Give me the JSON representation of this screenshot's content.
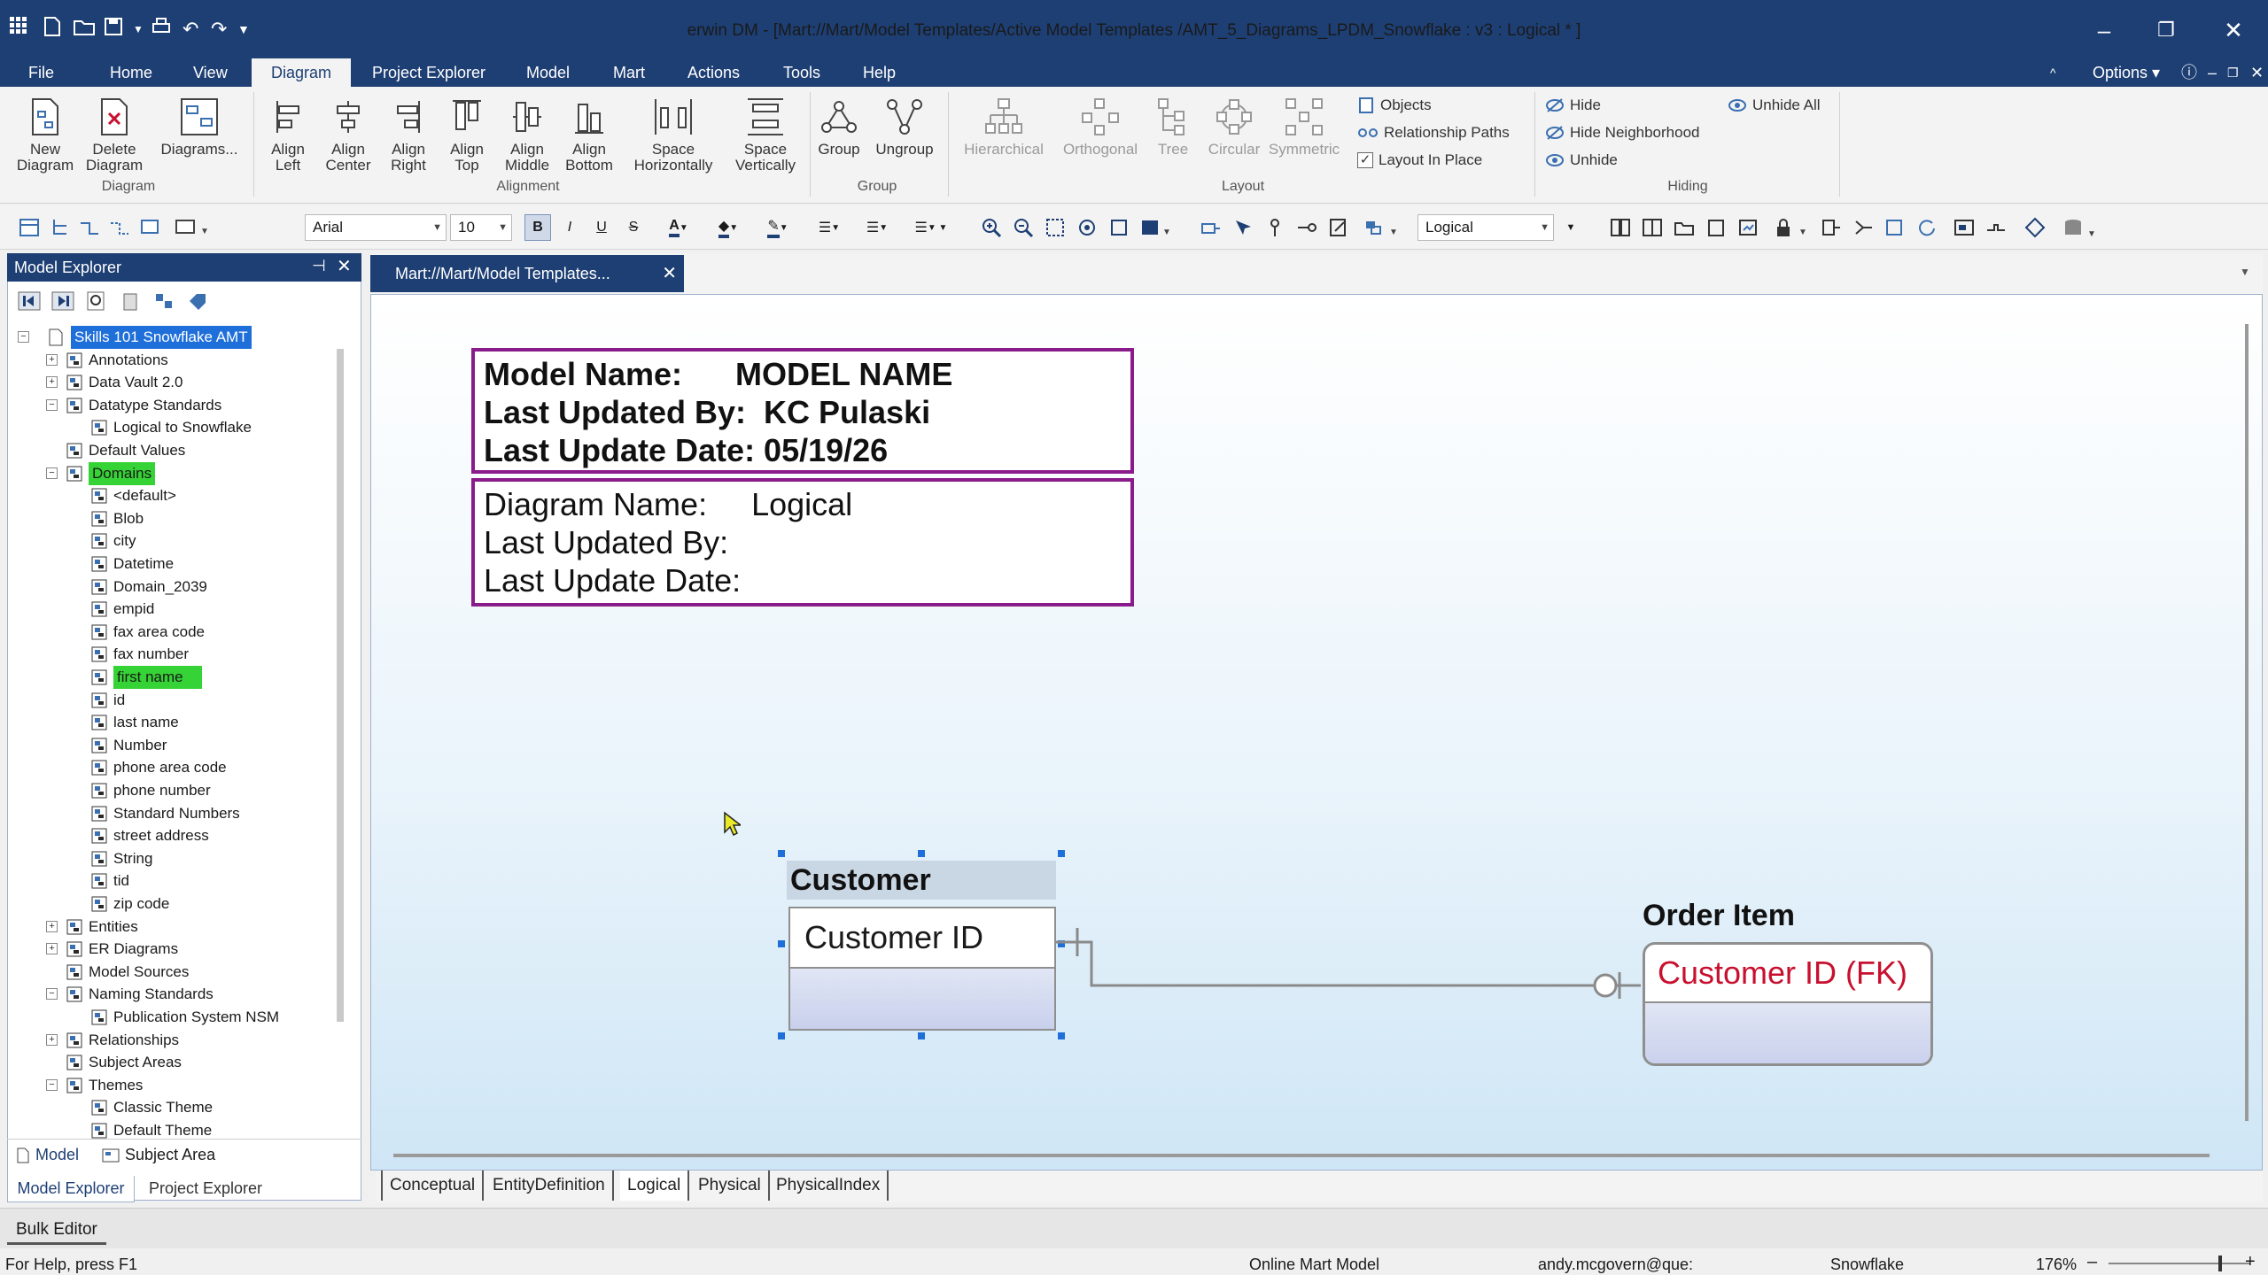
{
  "window": {
    "title": "erwin DM - [Mart://Mart/Model Templates/Active Model Templates /AMT_5_Diagrams_LPDM_Snowflake : v3 : Logical * ]",
    "controls": {
      "minimize": "–",
      "restore": "❐",
      "close": "✕"
    }
  },
  "menu": {
    "items": [
      "File",
      "Home",
      "View",
      "Diagram",
      "Project Explorer",
      "Model",
      "Mart",
      "Actions",
      "Tools",
      "Help"
    ],
    "active": "Diagram",
    "options": "Options"
  },
  "ribbon": {
    "diagram_group": {
      "label": "Diagram",
      "buttons": [
        "New\nDiagram",
        "Delete\nDiagram",
        "Diagrams..."
      ]
    },
    "alignment_group": {
      "label": "Alignment",
      "buttons": [
        "Align\nLeft",
        "Align\nCenter",
        "Align\nRight",
        "Align\nTop",
        "Align\nMiddle",
        "Align\nBottom",
        "Space\nHorizontally",
        "Space\nVertically"
      ]
    },
    "group_group": {
      "label": "Group",
      "buttons": [
        "Group",
        "Ungroup"
      ]
    },
    "layout_group": {
      "label": "Layout",
      "buttons": [
        "Hierarchical",
        "Orthogonal",
        "Tree",
        "Circular",
        "Symmetric"
      ],
      "options": [
        "Objects",
        "Relationship Paths",
        "Layout In Place"
      ],
      "layout_in_place_checked": true
    },
    "hiding_group": {
      "label": "Hiding",
      "buttons": [
        "Hide",
        "Hide Neighborhood",
        "Unhide",
        "Unhide All"
      ]
    }
  },
  "toolbar": {
    "font": "Arial",
    "size": "10",
    "view": "Logical"
  },
  "model_explorer": {
    "title": "Model Explorer",
    "root": "Skills 101 Snowflake AMT",
    "nodes": [
      {
        "label": "Annotations",
        "level": 1,
        "expander": "+"
      },
      {
        "label": "Data Vault 2.0",
        "level": 1,
        "expander": "+"
      },
      {
        "label": "Datatype Standards",
        "level": 1,
        "expander": "−"
      },
      {
        "label": "Logical to Snowflake",
        "level": 2,
        "expander": ""
      },
      {
        "label": "Default Values",
        "level": 1,
        "expander": ""
      },
      {
        "label": "Domains",
        "level": 1,
        "expander": "−",
        "highlight": "green"
      },
      {
        "label": "<default>",
        "level": 2,
        "expander": ""
      },
      {
        "label": "Blob",
        "level": 2,
        "expander": ""
      },
      {
        "label": "city",
        "level": 2,
        "expander": ""
      },
      {
        "label": "Datetime",
        "level": 2,
        "expander": ""
      },
      {
        "label": "Domain_2039",
        "level": 2,
        "expander": ""
      },
      {
        "label": "empid",
        "level": 2,
        "expander": ""
      },
      {
        "label": "fax area code",
        "level": 2,
        "expander": ""
      },
      {
        "label": "fax number",
        "level": 2,
        "expander": ""
      },
      {
        "label": "first name",
        "level": 2,
        "expander": "",
        "highlight": "green"
      },
      {
        "label": "id",
        "level": 2,
        "expander": ""
      },
      {
        "label": "last name",
        "level": 2,
        "expander": ""
      },
      {
        "label": "Number",
        "level": 2,
        "expander": ""
      },
      {
        "label": "phone area code",
        "level": 2,
        "expander": ""
      },
      {
        "label": "phone number",
        "level": 2,
        "expander": ""
      },
      {
        "label": "Standard Numbers",
        "level": 2,
        "expander": ""
      },
      {
        "label": "street address",
        "level": 2,
        "expander": ""
      },
      {
        "label": "String",
        "level": 2,
        "expander": ""
      },
      {
        "label": "tid",
        "level": 2,
        "expander": ""
      },
      {
        "label": "zip code",
        "level": 2,
        "expander": ""
      },
      {
        "label": "Entities",
        "level": 1,
        "expander": "+"
      },
      {
        "label": "ER Diagrams",
        "level": 1,
        "expander": "+"
      },
      {
        "label": "Model Sources",
        "level": 1,
        "expander": ""
      },
      {
        "label": "Naming Standards",
        "level": 1,
        "expander": "−"
      },
      {
        "label": "Publication System NSM",
        "level": 2,
        "expander": ""
      },
      {
        "label": "Relationships",
        "level": 1,
        "expander": "+"
      },
      {
        "label": "Subject Areas",
        "level": 1,
        "expander": ""
      },
      {
        "label": "Themes",
        "level": 1,
        "expander": "−"
      },
      {
        "label": "Classic Theme",
        "level": 2,
        "expander": ""
      },
      {
        "label": "Default Theme",
        "level": 2,
        "expander": ""
      }
    ],
    "bottom_tabs": [
      "Model",
      "Subject Area"
    ],
    "panel_tabs": [
      "Model Explorer",
      "Project Explorer"
    ]
  },
  "document": {
    "tab": "Mart://Mart/Model Templates...",
    "header_box1": [
      "Model Name:      MODEL NAME",
      "Last Updated By:  KC Pulaski",
      "Last Update Date: 05/19/26"
    ],
    "header_box2": [
      "Diagram Name:     Logical",
      "Last Updated By:",
      "Last Update Date:"
    ],
    "entities": [
      {
        "name": "Customer",
        "key_attr": "Customer ID",
        "color": "#111111"
      },
      {
        "name": "Order Item",
        "key_attr": "Customer ID (FK)",
        "color": "#c8102e"
      }
    ]
  },
  "diagram_tabs": [
    "Conceptual",
    "EntityDefinition",
    "Logical",
    "Physical",
    "PhysicalIndex"
  ],
  "active_diagram_tab": "Logical",
  "bulk_editor": "Bulk Editor",
  "status": {
    "help": "For Help, press F1",
    "mode": "Online Mart Model",
    "user": "andy.mcgovern@que:",
    "db": "Snowflake",
    "zoom": "176%"
  },
  "colors": {
    "brand": "#1e3f74",
    "header_border": "#8a1b8a",
    "fk_text": "#c8102e",
    "selection": "#1e6fd9",
    "highlight": "#35d335"
  }
}
